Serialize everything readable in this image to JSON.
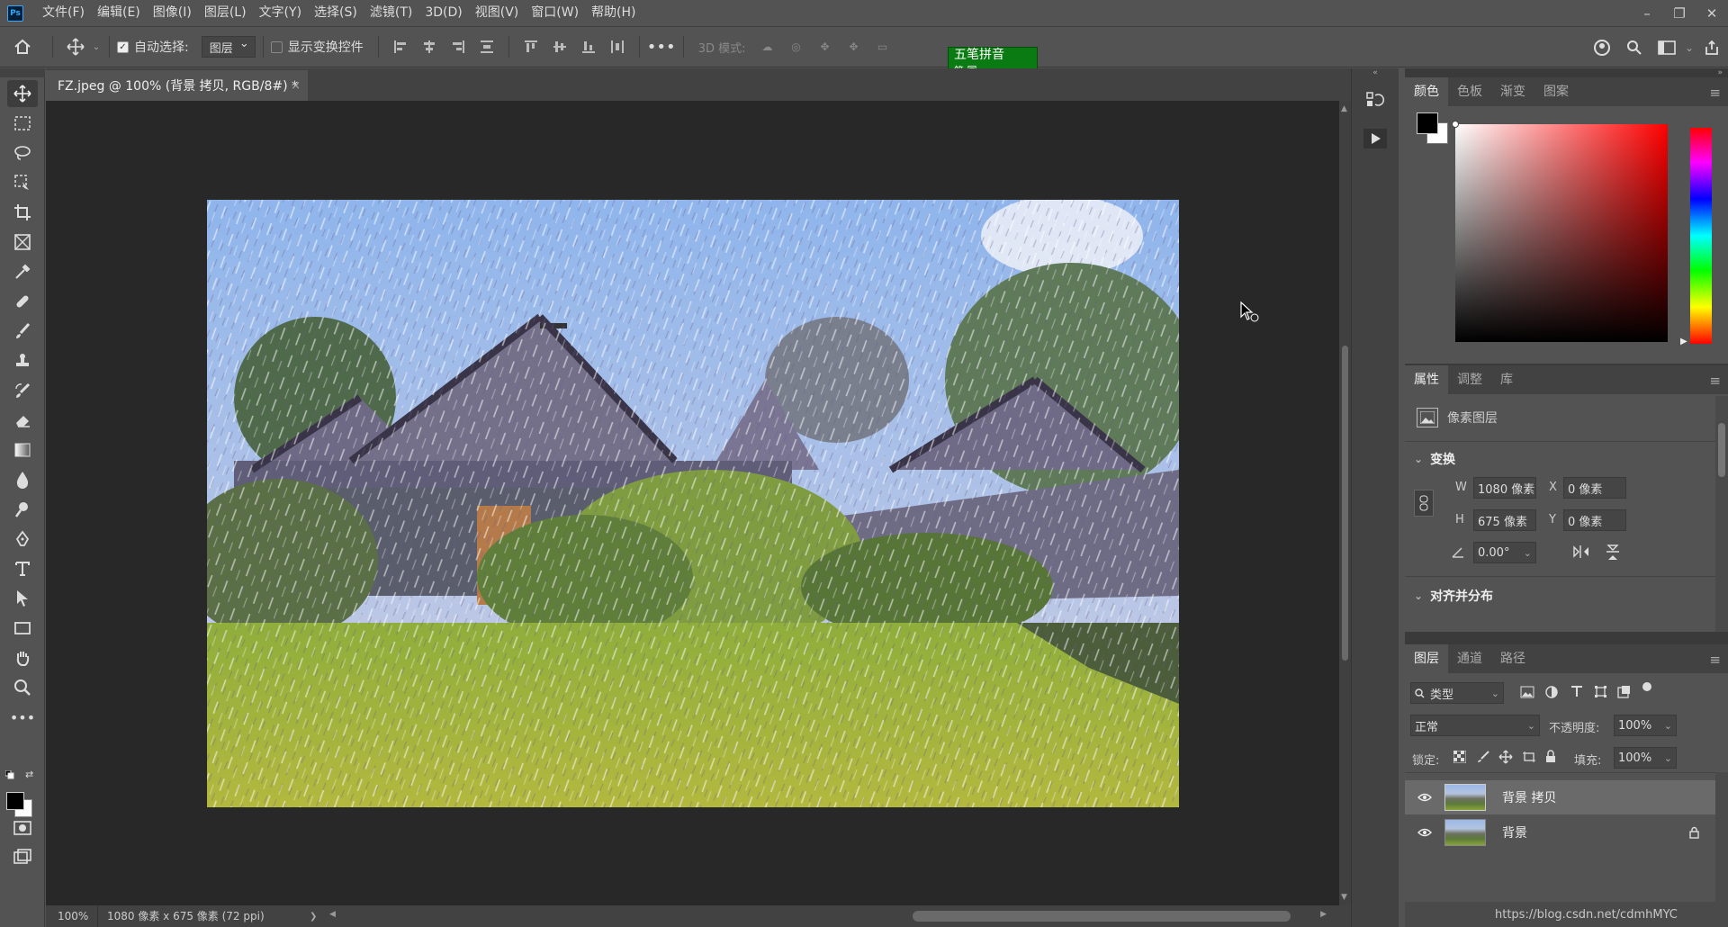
{
  "app": {
    "logo": "Ps"
  },
  "menu": [
    "文件(F)",
    "编辑(E)",
    "图像(I)",
    "图层(L)",
    "文字(Y)",
    "选择(S)",
    "滤镜(T)",
    "3D(D)",
    "视图(V)",
    "窗口(W)",
    "帮助(H)"
  ],
  "options": {
    "auto_select_label": "自动选择:",
    "auto_select_value": "图层",
    "show_transform_label": "显示变换控件",
    "mode_3d_label": "3D 模式:",
    "ime_line1": "五笔拼音",
    "ime_line2": "简 国"
  },
  "document": {
    "tab_title": "FZ.jpeg @ 100% (背景 拷贝, RGB/8#) *",
    "close": "×"
  },
  "status": {
    "zoom": "100%",
    "info": "1080 像素 x 675 像素 (72 ppi)",
    "arrow": "❯"
  },
  "color_panel": {
    "tabs": [
      "颜色",
      "色板",
      "渐变",
      "图案"
    ],
    "foreground": "#000000",
    "background": "#ffffff"
  },
  "properties_panel": {
    "tabs": [
      "属性",
      "调整",
      "库"
    ],
    "layer_type": "像素图层",
    "transform_title": "变换",
    "w_label": "W",
    "w_value": "1080 像素",
    "h_label": "H",
    "h_value": "675 像素",
    "x_label": "X",
    "x_value": "0 像素",
    "y_label": "Y",
    "y_value": "0 像素",
    "angle_value": "0.00°",
    "align_title": "对齐并分布"
  },
  "layers_panel": {
    "tabs": [
      "图层",
      "通道",
      "路径"
    ],
    "filter_label": "类型",
    "blend_mode": "正常",
    "opacity_label": "不透明度:",
    "opacity_value": "100%",
    "lock_label": "锁定:",
    "fill_label": "填充:",
    "fill_value": "100%",
    "layers": [
      {
        "name": "背景 拷贝",
        "selected": true
      },
      {
        "name": "背景",
        "selected": false,
        "locked": true
      }
    ]
  },
  "watermark": "https://blog.csdn.net/cdmhMYC"
}
